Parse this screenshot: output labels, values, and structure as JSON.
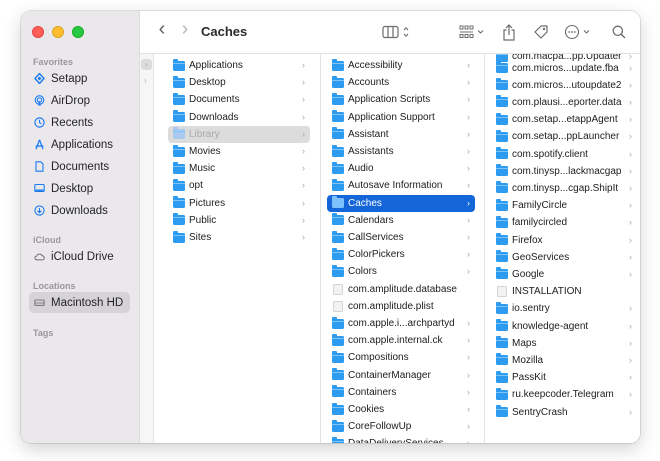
{
  "window": {
    "title": "Caches"
  },
  "sidebar": {
    "favorites_label": "Favorites",
    "favorites": [
      {
        "label": "Setapp",
        "icon": "setapp-icon"
      },
      {
        "label": "AirDrop",
        "icon": "airdrop-icon"
      },
      {
        "label": "Recents",
        "icon": "clock-icon"
      },
      {
        "label": "Applications",
        "icon": "applications-icon"
      },
      {
        "label": "Documents",
        "icon": "document-icon"
      },
      {
        "label": "Desktop",
        "icon": "desktop-icon"
      },
      {
        "label": "Downloads",
        "icon": "download-icon"
      }
    ],
    "icloud_label": "iCloud",
    "icloud": [
      {
        "label": "iCloud Drive",
        "icon": "cloud-icon"
      }
    ],
    "locations_label": "Locations",
    "locations": [
      {
        "label": "Macintosh HD",
        "icon": "drive-icon",
        "selected": true
      }
    ],
    "tags_label": "Tags"
  },
  "toolbar": {
    "back": "‹",
    "forward": "›",
    "title": "Caches",
    "view_mode_icon": "columns-view-icon",
    "group_icon": "group-icon",
    "share_icon": "share-icon",
    "tag_icon": "tag-icon",
    "more_icon": "more-icon",
    "search_icon": "search-icon"
  },
  "columns": [
    {
      "items": [
        {
          "label": "Applications",
          "type": "folder"
        },
        {
          "label": "Desktop",
          "type": "folder"
        },
        {
          "label": "Documents",
          "type": "folder"
        },
        {
          "label": "Downloads",
          "type": "folder"
        },
        {
          "label": "Library",
          "type": "folder",
          "state": "dim"
        },
        {
          "label": "Movies",
          "type": "folder"
        },
        {
          "label": "Music",
          "type": "folder"
        },
        {
          "label": "opt",
          "type": "folder"
        },
        {
          "label": "Pictures",
          "type": "folder"
        },
        {
          "label": "Public",
          "type": "folder"
        },
        {
          "label": "Sites",
          "type": "folder"
        }
      ]
    },
    {
      "items": [
        {
          "label": "Accessibility",
          "type": "folder"
        },
        {
          "label": "Accounts",
          "type": "folder"
        },
        {
          "label": "Application Scripts",
          "type": "folder"
        },
        {
          "label": "Application Support",
          "type": "folder"
        },
        {
          "label": "Assistant",
          "type": "folder"
        },
        {
          "label": "Assistants",
          "type": "folder"
        },
        {
          "label": "Audio",
          "type": "folder"
        },
        {
          "label": "Autosave Information",
          "type": "folder"
        },
        {
          "label": "Caches",
          "type": "folder",
          "state": "active"
        },
        {
          "label": "Calendars",
          "type": "folder"
        },
        {
          "label": "CallServices",
          "type": "folder"
        },
        {
          "label": "ColorPickers",
          "type": "folder"
        },
        {
          "label": "Colors",
          "type": "folder"
        },
        {
          "label": "com.amplitude.database",
          "type": "file"
        },
        {
          "label": "com.amplitude.plist",
          "type": "file"
        },
        {
          "label": "com.apple.i...archpartyd",
          "type": "folder"
        },
        {
          "label": "com.apple.internal.ck",
          "type": "folder"
        },
        {
          "label": "Compositions",
          "type": "folder"
        },
        {
          "label": "ContainerManager",
          "type": "folder"
        },
        {
          "label": "Containers",
          "type": "folder"
        },
        {
          "label": "Cookies",
          "type": "folder"
        },
        {
          "label": "CoreFollowUp",
          "type": "folder"
        },
        {
          "label": "DataDeliveryServices",
          "type": "folder"
        }
      ]
    },
    {
      "items": [
        {
          "label": "com.macpa...pp.Updater",
          "type": "folder"
        },
        {
          "label": "com.micros...update.fba",
          "type": "folder"
        },
        {
          "label": "com.micros...utoupdate2",
          "type": "folder"
        },
        {
          "label": "com.plausi...eporter.data",
          "type": "folder"
        },
        {
          "label": "com.setap...etappAgent",
          "type": "folder"
        },
        {
          "label": "com.setap...ppLauncher",
          "type": "folder"
        },
        {
          "label": "com.spotify.client",
          "type": "folder"
        },
        {
          "label": "com.tinysp...lackmacgap",
          "type": "folder"
        },
        {
          "label": "com.tinysp...cgap.ShipIt",
          "type": "folder"
        },
        {
          "label": "FamilyCircle",
          "type": "folder"
        },
        {
          "label": "familycircled",
          "type": "folder"
        },
        {
          "label": "Firefox",
          "type": "folder"
        },
        {
          "label": "GeoServices",
          "type": "folder"
        },
        {
          "label": "Google",
          "type": "folder"
        },
        {
          "label": "INSTALLATION",
          "type": "file"
        },
        {
          "label": "io.sentry",
          "type": "folder"
        },
        {
          "label": "knowledge-agent",
          "type": "folder"
        },
        {
          "label": "Maps",
          "type": "folder"
        },
        {
          "label": "Mozilla",
          "type": "folder"
        },
        {
          "label": "PassKit",
          "type": "folder"
        },
        {
          "label": "ru.keepcoder.Telegram",
          "type": "folder"
        },
        {
          "label": "SentryCrash",
          "type": "folder"
        }
      ]
    }
  ],
  "colors": {
    "selection_active": "#1466d8",
    "selection_dim": "#dcdcdc",
    "folder_blue": "#2d9cf0",
    "sidebar_bg": "#ebe8ec"
  }
}
